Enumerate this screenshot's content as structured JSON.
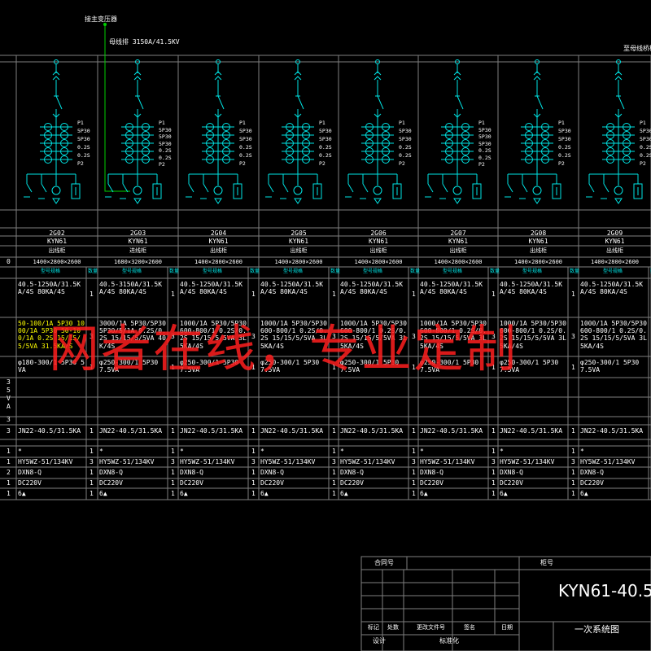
{
  "header": {
    "transformer_label": "接主变压器",
    "busbar_label": "母线排 3150A/41.5KV",
    "right_label": "至母线桥柜"
  },
  "ct_labels": [
    "P1",
    "5P30",
    "5P30",
    "0.2S",
    "0.2S",
    "P2"
  ],
  "ct_labels_alt": [
    "P1",
    "5P30",
    "5P30",
    "5P30",
    "0.2S",
    "0.2S",
    "P2"
  ],
  "columns": [
    {
      "code": "",
      "model": "",
      "use": "",
      "size": "",
      "partial": true
    },
    {
      "code": "2G02",
      "model": "KYN61",
      "use": "出线柜",
      "size": "1400×2800×2600"
    },
    {
      "code": "2G03",
      "model": "KYN61",
      "use": "进线柜",
      "size": "1680×3200×2600"
    },
    {
      "code": "2G04",
      "model": "KYN61",
      "use": "出线柜",
      "size": "1400×2800×2600"
    },
    {
      "code": "2G05",
      "model": "KYN61",
      "use": "出线柜",
      "size": "1400×2800×2600"
    },
    {
      "code": "2G06",
      "model": "KYN61",
      "use": "出线柜",
      "size": "1400×2800×2600"
    },
    {
      "code": "2G07",
      "model": "KYN61",
      "use": "出线柜",
      "size": "1400×2800×2600"
    },
    {
      "code": "2G08",
      "model": "KYN61",
      "use": "出线柜",
      "size": "1400×2800×2600"
    },
    {
      "code": "2G09",
      "model": "KYN61",
      "use": "出线柜",
      "size": "1400×2800×2600"
    }
  ],
  "col_head": {
    "spec": "型号规格",
    "qty": "数量"
  },
  "rows": {
    "breaker_a": "40.5-1250A/31.5KA/4S 80KA/4S",
    "breaker_b": "40.5-3150A/31.5KA/4S 80KA/4S",
    "ct_normal": "1000/1A 5P30/5P30 600-800/1 0.2S/0.2S 15/15/5/5VA 3L5KA/4S",
    "ct_yellow": "50-100/1A 5P30 1000/1A 5P30 50-100/1A 0.2S 15/15/5/5VA 31.5KA/S",
    "ct_b": "3000/1A 5P30/5P30 5P30/5/1A 0.2S/0.2S 15/15/5/5VA 40K/4S",
    "pt_normal": "φ250-300/1 5P30 7.5VA",
    "pt_first": "φ180-300/1 5P30 5VA",
    "earth_switch": "JN22-40.5/31.5KA",
    "star": "*",
    "arrester": "HY5WZ-51/134KV",
    "indicator": "DXN8-Q",
    "dc": "DC220V",
    "misc": "6▲"
  },
  "qty_values": [
    "1",
    "2",
    "3",
    "1",
    "1",
    "1"
  ],
  "left_partial": [
    "0",
    "3",
    "5",
    "V",
    "A",
    "3",
    "3",
    "1",
    "1",
    "2",
    "1",
    "1"
  ],
  "title_block": {
    "contract": "合同号",
    "drawing_no": "柜号",
    "mark": "标记",
    "count": "处数",
    "file": "更改文件号",
    "sign": "签名",
    "date": "日期",
    "design": "设计",
    "standard": "标准化",
    "product": "KYN61-40.5",
    "name": "一次系统图"
  },
  "watermark": "网者在线，专业定制",
  "colors": {
    "grid": "#7f7f7f",
    "cyan": "#00e5e5",
    "white": "#ffffff",
    "yellow": "#ffff00",
    "green": "#00d000",
    "watermark": "#ff2020"
  }
}
